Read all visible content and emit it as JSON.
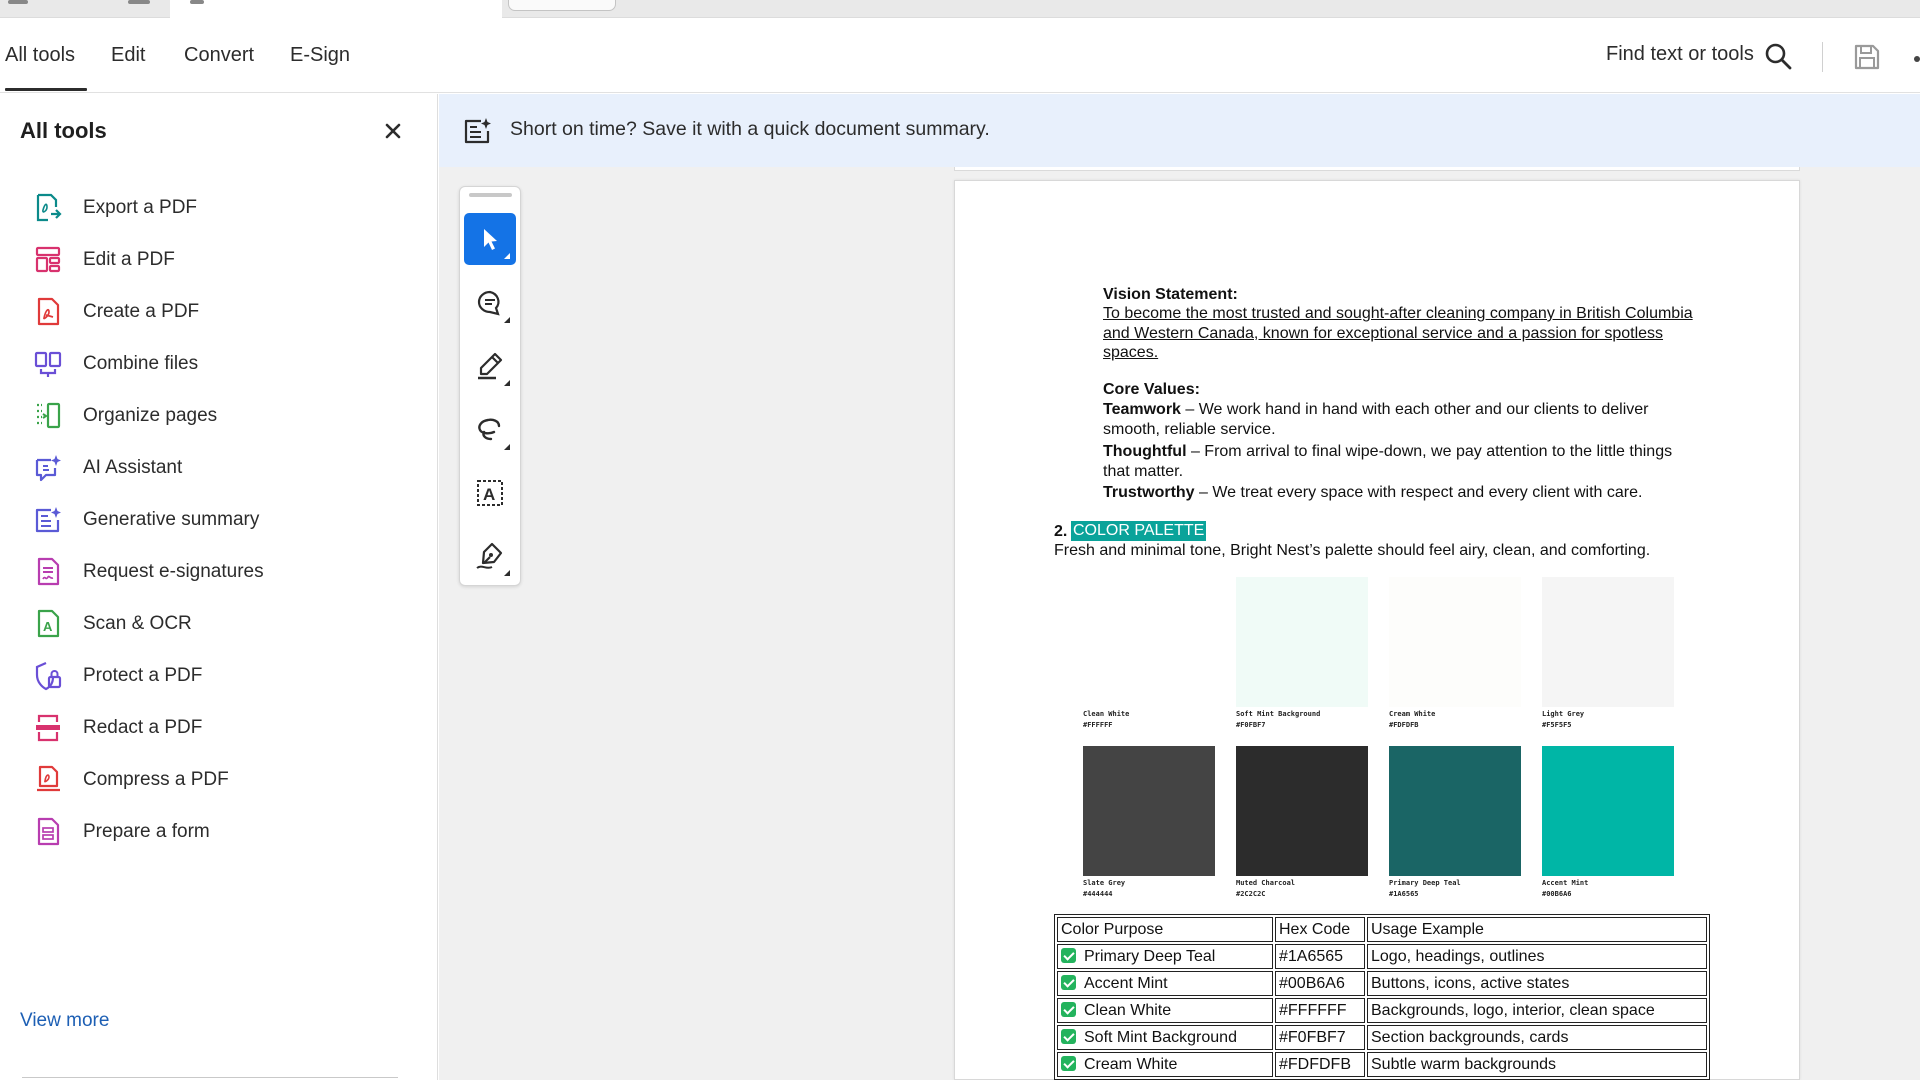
{
  "menubar": {
    "tabs": [
      {
        "label": "All tools",
        "active": true
      },
      {
        "label": "Edit",
        "active": false
      },
      {
        "label": "Convert",
        "active": false
      },
      {
        "label": "E-Sign",
        "active": false
      }
    ],
    "find_label": "Find text or tools",
    "icons": [
      "search-icon",
      "save-icon"
    ]
  },
  "panel": {
    "title": "All tools",
    "close_icon": "close-icon",
    "items": [
      {
        "label": "Export a PDF",
        "icon": "export-pdf-icon",
        "color": "#0b8a8a"
      },
      {
        "label": "Edit a PDF",
        "icon": "edit-pdf-icon",
        "color": "#d8326e"
      },
      {
        "label": "Create a PDF",
        "icon": "create-pdf-icon",
        "color": "#e03a3a"
      },
      {
        "label": "Combine files",
        "icon": "combine-files-icon",
        "color": "#6a4fd6"
      },
      {
        "label": "Organize pages",
        "icon": "organize-pages-icon",
        "color": "#3aa34a"
      },
      {
        "label": "AI Assistant",
        "icon": "ai-assistant-icon",
        "color": "#5a5ad6"
      },
      {
        "label": "Generative summary",
        "icon": "generative-summary-icon",
        "color": "#5a5ad6"
      },
      {
        "label": "Request e-signatures",
        "icon": "request-esignatures-icon",
        "color": "#b83db0"
      },
      {
        "label": "Scan & OCR",
        "icon": "scan-ocr-icon",
        "color": "#3aa34a"
      },
      {
        "label": "Protect a PDF",
        "icon": "protect-pdf-icon",
        "color": "#6a4fd6"
      },
      {
        "label": "Redact a PDF",
        "icon": "redact-pdf-icon",
        "color": "#d8326e"
      },
      {
        "label": "Compress a PDF",
        "icon": "compress-pdf-icon",
        "color": "#e03a3a"
      },
      {
        "label": "Prepare a form",
        "icon": "prepare-form-icon",
        "color": "#b83db0"
      }
    ],
    "view_more": "View more"
  },
  "banner": {
    "icon": "summary-spark-icon",
    "text": "Short on time? Save it with a quick document summary."
  },
  "toolrail": {
    "tools": [
      {
        "name": "select-tool",
        "icon": "cursor-icon",
        "active": true
      },
      {
        "name": "comment-tool",
        "icon": "comment-icon",
        "active": false
      },
      {
        "name": "highlight-tool",
        "icon": "pen-icon",
        "active": false
      },
      {
        "name": "draw-tool",
        "icon": "lasso-icon",
        "active": false
      },
      {
        "name": "text-tool",
        "icon": "text-box-icon",
        "active": false
      },
      {
        "name": "sign-tool",
        "icon": "signature-pen-icon",
        "active": false
      }
    ]
  },
  "document": {
    "vision_heading": "Vision Statement:",
    "vision_text": "To become the most trusted and sought-after cleaning company in British Columbia and Western Canada, known for exceptional service and a passion for spotless spaces.",
    "values_heading": "Core Values:",
    "values": [
      {
        "term": "Teamwork",
        "desc": " – We work hand in hand with each other and our clients to deliver smooth, reliable service."
      },
      {
        "term": "Thoughtful",
        "desc": " – From arrival to final wipe-down, we pay attention to the little things that matter."
      },
      {
        "term": "Trustworthy",
        "desc": " – We treat every space with respect and every client with care."
      }
    ],
    "section_number": "2.",
    "section_title": "COLOR PALETTE",
    "section_desc": "Fresh and minimal tone, Bright Nest’s palette should feel airy, clean, and comforting.",
    "swatches": [
      {
        "name": "Clean White",
        "hex": "#FFFFFF",
        "color": "#FFFFFF"
      },
      {
        "name": "Soft Mint Background",
        "hex": "#F0FBF7",
        "color": "#F0FBF7"
      },
      {
        "name": "Cream White",
        "hex": "#FDFDFB",
        "color": "#FDFDFB"
      },
      {
        "name": "Light Grey",
        "hex": "#F5F5F5",
        "color": "#F5F5F5"
      },
      {
        "name": "Slate Grey",
        "hex": "#444444",
        "color": "#444444"
      },
      {
        "name": "Muted Charcoal",
        "hex": "#2C2C2C",
        "color": "#2C2C2C"
      },
      {
        "name": "Primary Deep Teal",
        "hex": "#1A6565",
        "color": "#1A6565"
      },
      {
        "name": "Accent Mint",
        "hex": "#00B6A6",
        "color": "#00B6A6"
      }
    ],
    "table": {
      "headers": [
        "Color Purpose",
        "Hex Code",
        "Usage Example"
      ],
      "rows": [
        {
          "purpose": "Primary Deep Teal",
          "hex": "#1A6565",
          "usage": "Logo, headings, outlines"
        },
        {
          "purpose": "Accent Mint",
          "hex": "#00B6A6",
          "usage": "Buttons, icons, active states"
        },
        {
          "purpose": "Clean White",
          "hex": "#FFFFFF",
          "usage": "Backgrounds, logo, interior, clean space"
        },
        {
          "purpose": "Soft Mint Background",
          "hex": "#F0FBF7",
          "usage": "Section backgrounds, cards"
        },
        {
          "purpose": "Cream White",
          "hex": "#FDFDFB",
          "usage": "Subtle warm backgrounds"
        }
      ]
    }
  }
}
